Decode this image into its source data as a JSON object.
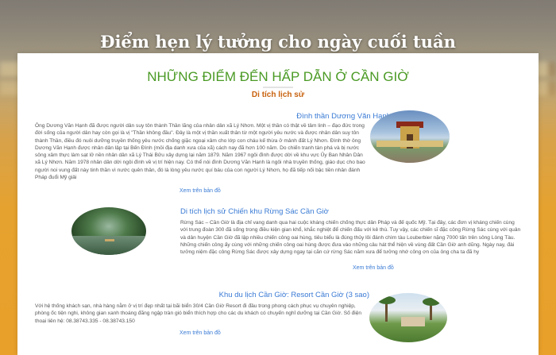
{
  "hero": {
    "title": "Điểm hẹn lý tưởng cho ngày cuối tuần"
  },
  "section": {
    "title": "NHỮNG ĐIỂM ĐẾN HẤP DẪN Ở CẦN GIỜ",
    "subsection": "Di tích lịch sử"
  },
  "items": [
    {
      "title": "Đình thần Dương Văn Hạnh",
      "body": "Ông Dương Văn Hạnh đã được người dân suy tôn thành Thần lãng của nhân dân xã Lý Nhơn. Một vị thần có thật về tâm linh – đạo đức trong đời sống của người dân hay còn gọi là vị \"Thần không đầu\". Đây là một vị thần xuất thân từ một người yêu nước và được nhân dân suy tôn thành Thần, điều đó nuôi dưỡng truyền thống yêu nước chống giặc ngoại xâm cho lớp con cháu kế thừa ở mảnh đất Lý Nhơn. Đình thờ ông Dương Văn Hạnh được nhân dân lập tại Bến Đình (mỏi địa danh xưa của xã) cách nay đã hơn 100 năm. Do chiến tranh tàn phá và bị nước sông xâm thực làm sạt lở nền nhân dân xã Lý Thái Bửu xây dựng lại năm 1879. Năm 1967 ngôi đình được dời về khu vực Ủy Ban Nhân Dân xã Lý Nhơn. Năm 1978 nhân dân dời ngôi đình về vị trí hiện nay. Có thể nói đình Dương Văn Hạnh là ngôi nhà truyền thống, giáo dục cho bao người noi vung đất này tinh thần vì nước quên thân, đó là lòng yêu nước quí báu của con người Lý Nhơn, họ đã tiếp nối bậc tiền nhân đánh Pháp đuổi Mỹ giải",
      "link": "Xem trên bản đồ"
    },
    {
      "title": "Di tích lịch sử Chiến khu Rừng Sác Cần Giờ",
      "body": "Rừng Sác – Cần Giờ là địa chỉ vang danh qua hai cuộc kháng chiến chống thực dân Pháp và đế quốc Mỹ. Tại đây, các đơn vị kháng chiến cùng với trung đoàn 300 đã sống trong điều kiện gian khổ, khắc nghiệt để chiến đấu với kẻ thù. Tuy vậy, các chiến sĩ đặc công Rừng Sác cùng với quân và dân huyện Cần Giờ đã lập nhiều chiến công oai hùng, tiêu biểu là đúng thủy lôi đánh chìm tàu Louberbier nặng 7000 tấn trên sông Lòng Tàu. Những chiến công ấy cùng với những chiến công oai hùng được đưa vào những câu hát thể hiện về vùng đất Cần Giờ anh dũng. Ngày nay, đài tưởng niệm đặc công Rừng Sác được xây dựng ngay tại căn cứ rừng Sác năm xưa để tưởng nhớ công ơn của ông cha ta đã hy",
      "link": "Xem trên bản đồ"
    },
    {
      "title": "Khu du lịch Cần Giờ: Resort Cần Giờ (3 sao)",
      "body": "Với hệ thống khách sạn, nhà hàng nằm ở vị trí đẹp nhất tại bãi biển 30/4 Cần Giờ Resort đi đầu trong phong cách phục vụ chuyên nghiệp, phòng ốc tiện nghi, không gian xanh thoáng đãng ngập tràn gió biển thích hợp cho các du khách có chuyến nghỉ dưỡng tại Cần Giờ. Số điện thoại liên hệ: 08.38743.335 - 08.38743.150",
      "link": "Xem trên bản đồ"
    }
  ],
  "colors": {
    "accent_green": "#4a9a24",
    "accent_orange": "#c8620e",
    "link_blue": "#3a7bd5"
  }
}
